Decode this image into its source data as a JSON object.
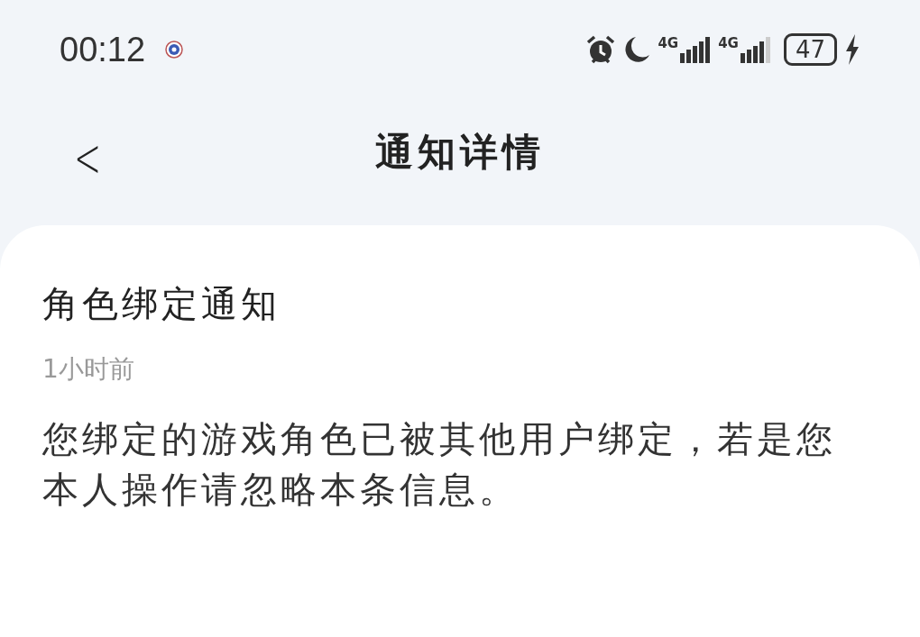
{
  "status_bar": {
    "time": "00:12",
    "network_1": "4G",
    "network_2": "4G",
    "battery": "47"
  },
  "header": {
    "back": "<",
    "title": "通知详情"
  },
  "notification": {
    "title": "角色绑定通知",
    "time": "1小时前",
    "body": "您绑定的游戏角色已被其他用户绑定，若是您本人操作请忽略本条信息。"
  }
}
